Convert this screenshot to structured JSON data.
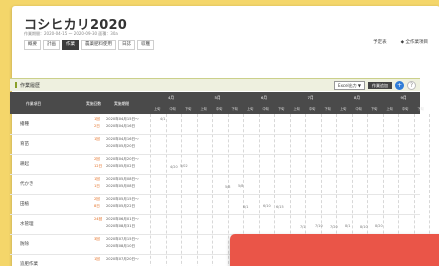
{
  "app": {
    "title": "コシヒカリ2020",
    "subtitle": "作業期間：2020-04-15 〜 2020-09-30 面積：30a"
  },
  "tabs": [
    "概要",
    "計画",
    "作業",
    "農薬肥料使用",
    "日誌",
    "収穫"
  ],
  "active_tab": 2,
  "header_links": [
    "予定表",
    "◆ 全作業項目"
  ],
  "section": {
    "title": "作業履歴",
    "export_button": "Excel出力 ▼",
    "dark_button": "作業追加",
    "blue_button_icon": "+",
    "gray_button_icon": "?"
  },
  "table": {
    "headers": [
      "作業項目",
      "実施回数",
      "実施期間"
    ],
    "months": [
      "4月",
      "5月",
      "6月",
      "7月",
      "8月",
      "9月"
    ],
    "subheaders": [
      "上旬",
      "中旬",
      "下旬"
    ],
    "rows": [
      {
        "crop": "播種",
        "count1": "1回",
        "date1": "2020年04月15日〜",
        "count2": "2日",
        "date2": "2020年04月16日",
        "marks": [
          "4/1"
        ]
      },
      {
        "crop": "育苗",
        "count1": "1回",
        "date1": "2020年04月16日〜",
        "count2": "",
        "date2": "2020年05月20日",
        "marks": []
      },
      {
        "crop": "耕起",
        "count1": "2回",
        "date1": "2020年04月20日〜",
        "count2": "12日",
        "date2": "2020年05月02日",
        "marks": [
          "4/20",
          "5/02"
        ]
      },
      {
        "crop": "代かき",
        "count1": "1回",
        "date1": "2020年05月08日〜",
        "count2": "1日",
        "date2": "2020年05月08日",
        "marks": [
          "5/8",
          "5/8"
        ]
      },
      {
        "crop": "田植",
        "count1": "2回",
        "date1": "2020年05月15日〜",
        "count2": "8日",
        "date2": "2020年05月22日",
        "marks": [
          "6/1",
          "6/10",
          "6/15"
        ]
      },
      {
        "crop": "水管理",
        "count1": "24回",
        "date1": "2020年06月01日〜",
        "count2": "",
        "date2": "2020年08月31日",
        "marks": [
          "7/1",
          "7/10",
          "7/20",
          "8/1",
          "8/10",
          "8/20"
        ]
      },
      {
        "crop": "防除",
        "count1": "3回",
        "date1": "2020年07月15日〜",
        "count2": "",
        "date2": "2020年08月10日",
        "marks": [
          "8/5"
        ]
      },
      {
        "crop": "追肥作業",
        "count1": "1回",
        "date1": "2020年07月20日〜",
        "count2": "",
        "date2": "",
        "marks": []
      }
    ]
  }
}
